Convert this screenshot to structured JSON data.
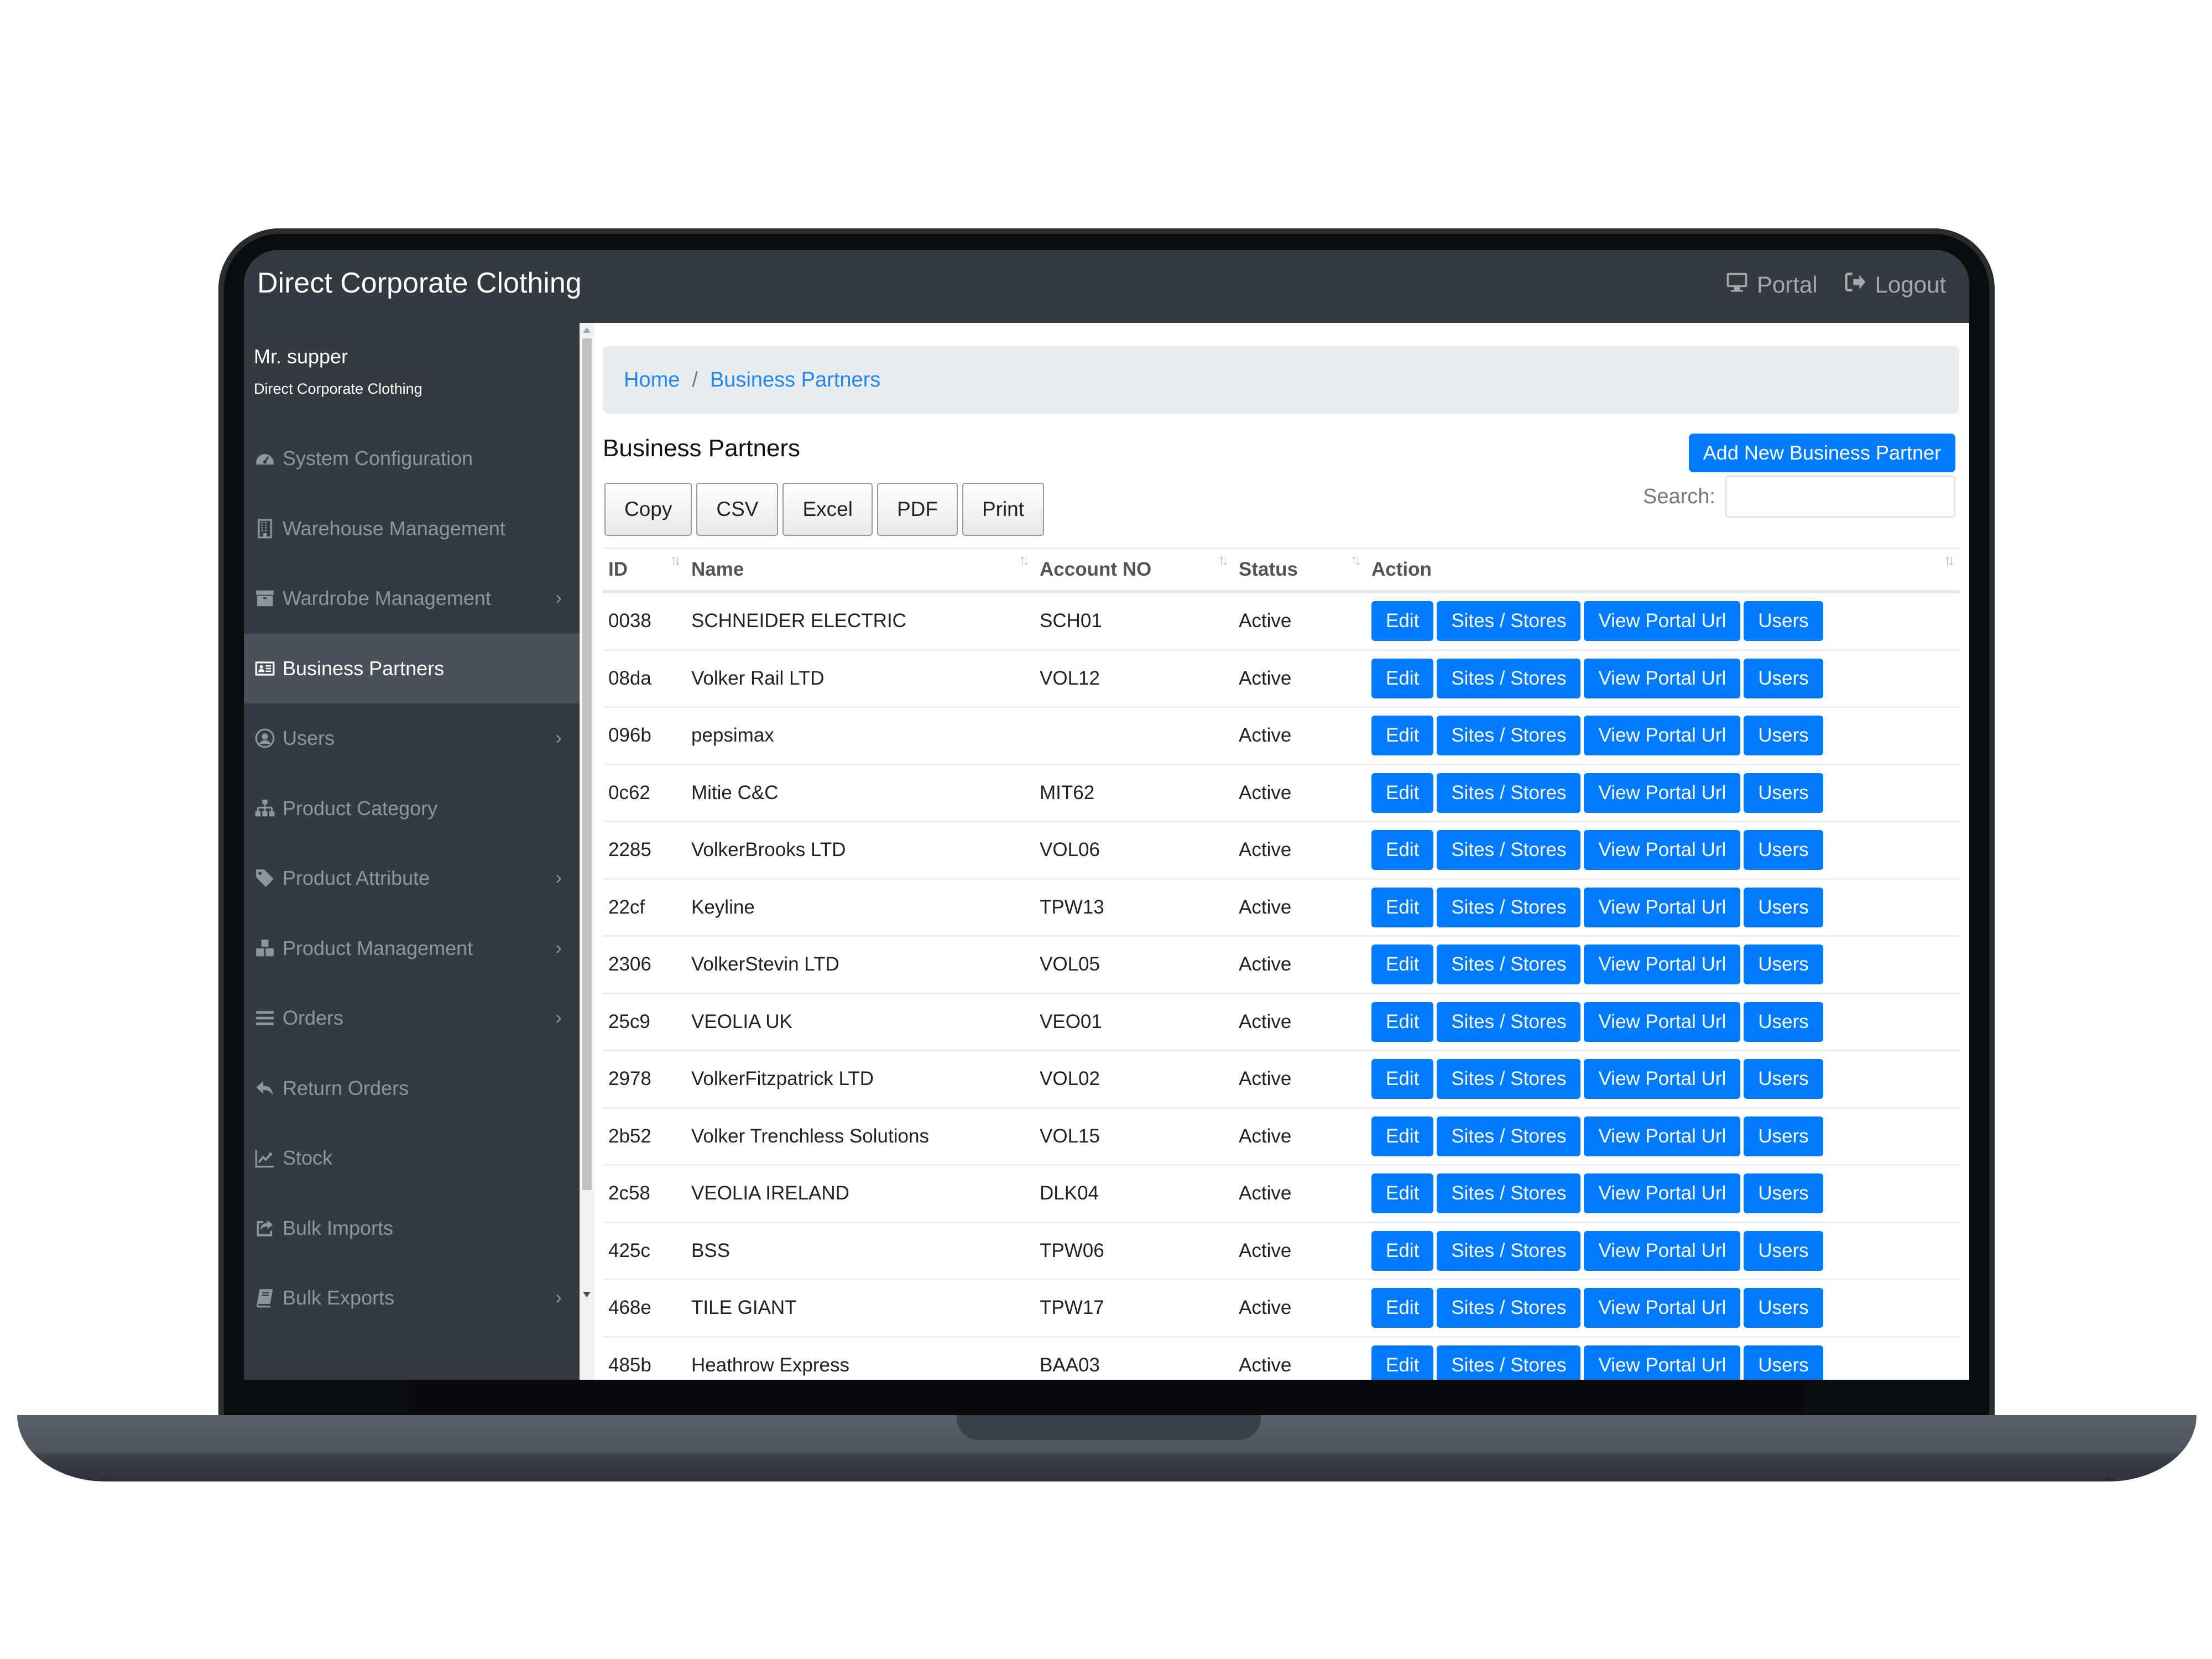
{
  "app": {
    "brand": "Direct Corporate Clothing",
    "nav_links": [
      {
        "label": "Portal",
        "icon": "monitor-icon"
      },
      {
        "label": "Logout",
        "icon": "sign-out-icon"
      }
    ]
  },
  "sidebar": {
    "user_name": "Mr. supper",
    "user_org": "Direct Corporate Clothing",
    "items": [
      {
        "label": "System Configuration",
        "icon": "dashboard-icon",
        "has_submenu": false,
        "active": false
      },
      {
        "label": "Warehouse Management",
        "icon": "building-icon",
        "has_submenu": false,
        "active": false
      },
      {
        "label": "Wardrobe Management",
        "icon": "archive-icon",
        "has_submenu": true,
        "active": false
      },
      {
        "label": "Business Partners",
        "icon": "id-card-icon",
        "has_submenu": false,
        "active": true
      },
      {
        "label": "Users",
        "icon": "user-circle-icon",
        "has_submenu": true,
        "active": false
      },
      {
        "label": "Product Category",
        "icon": "sitemap-icon",
        "has_submenu": false,
        "active": false
      },
      {
        "label": "Product Attribute",
        "icon": "tag-icon",
        "has_submenu": true,
        "active": false
      },
      {
        "label": "Product Management",
        "icon": "cubes-icon",
        "has_submenu": true,
        "active": false
      },
      {
        "label": "Orders",
        "icon": "list-icon",
        "has_submenu": true,
        "active": false
      },
      {
        "label": "Return Orders",
        "icon": "reply-icon",
        "has_submenu": false,
        "active": false
      },
      {
        "label": "Stock",
        "icon": "line-chart-icon",
        "has_submenu": false,
        "active": false
      },
      {
        "label": "Bulk Imports",
        "icon": "share-square-icon",
        "has_submenu": false,
        "active": false
      },
      {
        "label": "Bulk Exports",
        "icon": "book-icon",
        "has_submenu": true,
        "active": false
      }
    ]
  },
  "breadcrumb": {
    "home": "Home",
    "separator": "/",
    "current": "Business Partners"
  },
  "page": {
    "title": "Business Partners",
    "add_button": "Add New Business Partner",
    "export_buttons": [
      "Copy",
      "CSV",
      "Excel",
      "PDF",
      "Print"
    ],
    "search_label": "Search:",
    "search_value": ""
  },
  "table": {
    "columns": [
      "ID",
      "Name",
      "Account NO",
      "Status",
      "Action"
    ],
    "action_labels": [
      "Edit",
      "Sites / Stores",
      "View Portal Url",
      "Users"
    ],
    "rows": [
      {
        "id": "0038",
        "name": "SCHNEIDER ELECTRIC",
        "account": "SCH01",
        "status": "Active"
      },
      {
        "id": "08da",
        "name": "Volker Rail LTD",
        "account": "VOL12",
        "status": "Active"
      },
      {
        "id": "096b",
        "name": "pepsimax",
        "account": "",
        "status": "Active"
      },
      {
        "id": "0c62",
        "name": "Mitie C&C",
        "account": "MIT62",
        "status": "Active"
      },
      {
        "id": "2285",
        "name": "VolkerBrooks LTD",
        "account": "VOL06",
        "status": "Active"
      },
      {
        "id": "22cf",
        "name": "Keyline",
        "account": "TPW13",
        "status": "Active"
      },
      {
        "id": "2306",
        "name": "VolkerStevin LTD",
        "account": "VOL05",
        "status": "Active"
      },
      {
        "id": "25c9",
        "name": "VEOLIA UK",
        "account": "VEO01",
        "status": "Active"
      },
      {
        "id": "2978",
        "name": "VolkerFitzpatrick LTD",
        "account": "VOL02",
        "status": "Active"
      },
      {
        "id": "2b52",
        "name": "Volker Trenchless Solutions",
        "account": "VOL15",
        "status": "Active"
      },
      {
        "id": "2c58",
        "name": "VEOLIA IRELAND",
        "account": "DLK04",
        "status": "Active"
      },
      {
        "id": "425c",
        "name": "BSS",
        "account": "TPW06",
        "status": "Active"
      },
      {
        "id": "468e",
        "name": "TILE GIANT",
        "account": "TPW17",
        "status": "Active"
      },
      {
        "id": "485b",
        "name": "Heathrow Express",
        "account": "BAA03",
        "status": "Active"
      }
    ]
  },
  "colors": {
    "primary": "#007bff",
    "navbar_bg": "#343a40",
    "sidebar_active_bg": "#495057",
    "link": "#1e87f0"
  }
}
